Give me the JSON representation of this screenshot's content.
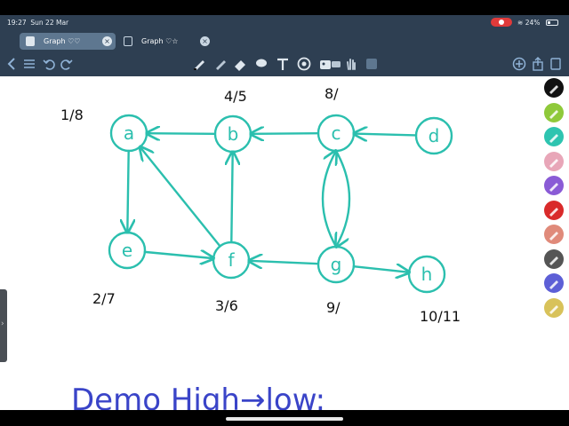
{
  "status_bar": {
    "time": "19:27",
    "date": "Sun 22 Mar",
    "battery": "24%"
  },
  "tabs": [
    {
      "label": "Graph ♡♡",
      "active": true
    },
    {
      "label": "Graph ♡☆",
      "active": false
    }
  ],
  "graph": {
    "nodes": [
      {
        "id": "a",
        "label": "a",
        "annotation": "1/8"
      },
      {
        "id": "b",
        "label": "b",
        "annotation": "4/5"
      },
      {
        "id": "c",
        "label": "c",
        "annotation": "8/"
      },
      {
        "id": "d",
        "label": "d",
        "annotation": ""
      },
      {
        "id": "e",
        "label": "e",
        "annotation": "2/7"
      },
      {
        "id": "f",
        "label": "f",
        "annotation": "3/6"
      },
      {
        "id": "g",
        "label": "g",
        "annotation": "9/"
      },
      {
        "id": "h",
        "label": "h",
        "annotation": "10/11"
      }
    ],
    "edges": [
      {
        "from": "b",
        "to": "a"
      },
      {
        "from": "c",
        "to": "b"
      },
      {
        "from": "d",
        "to": "c"
      },
      {
        "from": "a",
        "to": "e"
      },
      {
        "from": "e",
        "to": "f"
      },
      {
        "from": "f",
        "to": "a"
      },
      {
        "from": "f",
        "to": "b"
      },
      {
        "from": "g",
        "to": "f"
      },
      {
        "from": "g",
        "to": "h"
      },
      {
        "from": "c",
        "to": "g"
      },
      {
        "from": "g",
        "to": "c"
      }
    ],
    "edge_color": "#2bbfae"
  },
  "bottom_note": "Demo High→low:",
  "palette_colors": [
    "#111111",
    "#8fc93a",
    "#2ec4b0",
    "#e8a6b8",
    "#8a5bd6",
    "#d92a2a",
    "#e08a7a",
    "#555555",
    "#5d5fd6",
    "#d8c25a"
  ],
  "colors": {
    "chrome": "#2e3f52",
    "ink": "#111111"
  }
}
